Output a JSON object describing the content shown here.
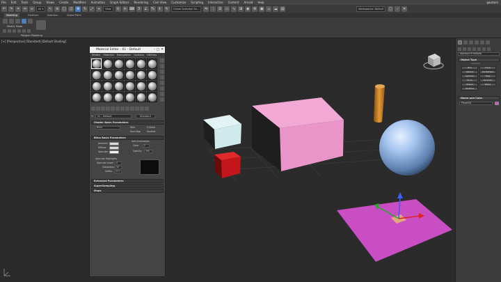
{
  "menubar": {
    "items": [
      "File",
      "Edit",
      "Tools",
      "Group",
      "Views",
      "Create",
      "Modifiers",
      "Animation",
      "Graph Editors",
      "Rendering",
      "Civil View",
      "Customize",
      "Scripting",
      "Interactive",
      "Content",
      "Arnold",
      "Help"
    ],
    "user": "gautami"
  },
  "toolbar": {
    "view_select": "View",
    "selection_set": "Create Selection Se...",
    "workspace": "Workspaces: Default"
  },
  "ribbon": {
    "tabs": [
      "Modeling",
      "Freeform",
      "Selection",
      "Object Paint"
    ],
    "active_tab": "Modeling",
    "group_label": "Modify Mode",
    "footer_label": "Polygon Modeling"
  },
  "viewport": {
    "label": "[+] [Perspective] [Standard] [Default Shading]"
  },
  "material_editor": {
    "title": "Material Editor - 01 - Default",
    "menu": [
      "Modes",
      "Material",
      "Navigation",
      "Options",
      "Utilities"
    ],
    "material_name": "01 - Default",
    "material_type": "Standard",
    "shader_rollout": "Shader Basic Parameters",
    "shader": "Blinn",
    "wire_label": "Wire",
    "two_sided_label": "2-Sided",
    "face_map_label": "Face Map",
    "faceted_label": "Faceted",
    "blinn_rollout": "Blinn Basic Parameters",
    "ambient_label": "Ambient:",
    "diffuse_label": "Diffuse:",
    "specular_label": "Specular:",
    "self_illum_label": "Self-Illumination",
    "color_label": "Color",
    "color_value": "0",
    "opacity_label": "Opacity:",
    "opacity_value": "100",
    "spec_highlights_label": "Specular Highlights",
    "spec_level_label": "Specular Level:",
    "spec_level_value": "0",
    "glossiness_label": "Glossiness:",
    "glossiness_value": "10",
    "soften_label": "Soften:",
    "soften_value": "0.1",
    "extended_rollout": "Extended Parameters",
    "supersampling_rollout": "SuperSampling",
    "maps_rollout": "Maps"
  },
  "command_panel": {
    "category": "Standard Primitives",
    "object_type_rollout": "Object Type",
    "autogrid_label": "AutoGrid",
    "objects": [
      "Box",
      "Cone",
      "Sphere",
      "GeoSphere",
      "Cylinder",
      "Tube",
      "Torus",
      "Pyramid",
      "Teapot",
      "Plane",
      "TextPlus"
    ],
    "name_color_rollout": "Name and Color",
    "object_name": "Plane001",
    "object_color": "#c958c2"
  },
  "colors": {
    "pink_box": "#e995c9",
    "light_blue_box": "#cfe9ec",
    "red_box": "#c4151b",
    "orange_cylinder": "#c97a1a",
    "blue_sphere": "#8fb5e6",
    "magenta_plane": "#c94dc3"
  }
}
